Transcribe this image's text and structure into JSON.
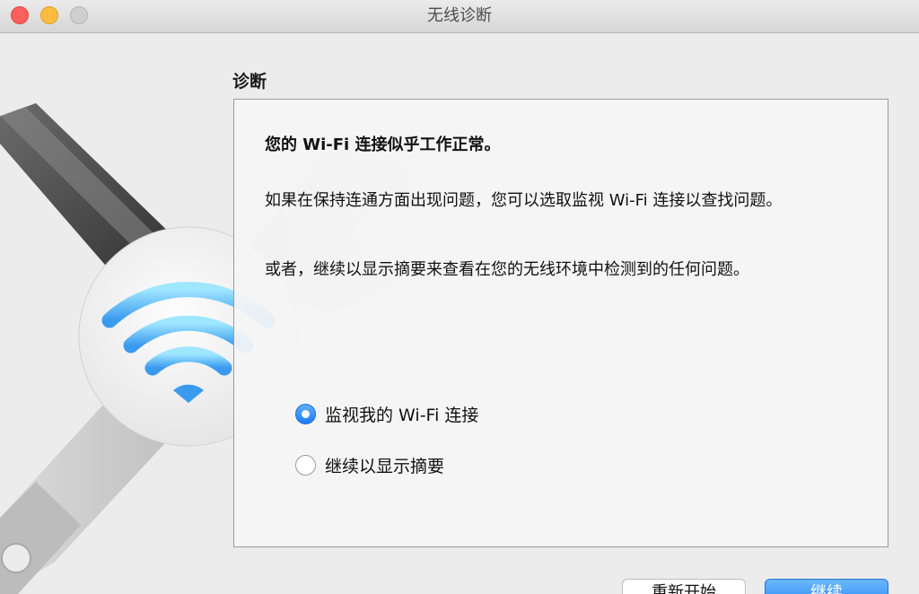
{
  "window": {
    "title": "无线诊断",
    "accent_color": "#1d7bf2"
  },
  "section": {
    "title": "诊断"
  },
  "panel": {
    "headline": "您的 Wi-Fi 连接似乎工作正常。",
    "paragraph1": "如果在保持连通方面出现问题，您可以选取监视 Wi-Fi 连接以查找问题。",
    "paragraph2": "或者，继续以显示摘要来查看在您的无线环境中检测到的任何问题。"
  },
  "options": [
    {
      "label": "监视我的 Wi-Fi 连接",
      "selected": true
    },
    {
      "label": "继续以显示摘要",
      "selected": false
    }
  ],
  "buttons": {
    "restart": "重新开始",
    "continue": "继续"
  },
  "icons": {
    "art": "wifi-wrench-icon"
  }
}
